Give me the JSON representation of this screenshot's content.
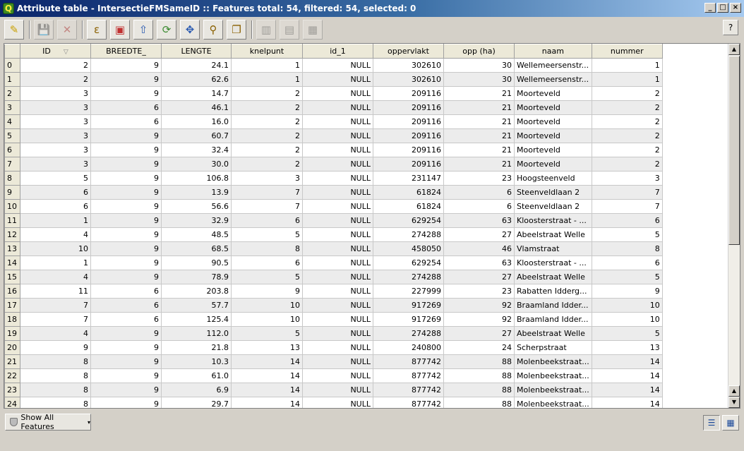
{
  "window": {
    "title": "Attribute table - IntersectieFMSameID :: Features total: 54, filtered: 54, selected: 0",
    "app_icon_letter": "Q",
    "minimize": "_",
    "maximize": "□",
    "close": "×"
  },
  "toolbar": {
    "icons": [
      {
        "name": "toggle-editing-icon",
        "glyph": "✎",
        "color": "#c8a000",
        "disabled": false
      },
      {
        "name": "save-edits-icon",
        "glyph": "💾",
        "color": "#606060",
        "disabled": true
      },
      {
        "name": "delete-selected-icon",
        "glyph": "✕",
        "color": "#b03030",
        "disabled": true
      },
      {
        "name": "expression-select-icon",
        "glyph": "ε",
        "color": "#8a6000",
        "disabled": false
      },
      {
        "name": "unselect-all-icon",
        "glyph": "▣",
        "color": "#c03030",
        "disabled": false
      },
      {
        "name": "move-selection-top-icon",
        "glyph": "⇧",
        "color": "#2a5ab0",
        "disabled": false
      },
      {
        "name": "invert-selection-icon",
        "glyph": "⟳",
        "color": "#3a8a30",
        "disabled": false
      },
      {
        "name": "pan-to-selection-icon",
        "glyph": "✥",
        "color": "#2a5ab0",
        "disabled": false
      },
      {
        "name": "zoom-to-selection-icon",
        "glyph": "⚲",
        "color": "#8a6000",
        "disabled": false
      },
      {
        "name": "copy-rows-icon",
        "glyph": "❐",
        "color": "#8a6000",
        "disabled": false
      },
      {
        "name": "new-column-icon",
        "glyph": "▥",
        "color": "#606060",
        "disabled": true
      },
      {
        "name": "delete-column-icon",
        "glyph": "▤",
        "color": "#606060",
        "disabled": true
      },
      {
        "name": "field-calculator-icon",
        "glyph": "▦",
        "color": "#606060",
        "disabled": true
      }
    ],
    "help": "?"
  },
  "table": {
    "columns": [
      "ID",
      "BREEDTE_",
      "LENGTE",
      "knelpunt",
      "id_1",
      "oppervlakt",
      "opp (ha)",
      "naam",
      "nummer"
    ],
    "sort_indicator": "▽",
    "rows": [
      [
        "0",
        "2",
        "9",
        "24.1",
        "1",
        "NULL",
        "302610",
        "30",
        "Wellemeersenstr...",
        "1"
      ],
      [
        "1",
        "2",
        "9",
        "62.6",
        "1",
        "NULL",
        "302610",
        "30",
        "Wellemeersenstr...",
        "1"
      ],
      [
        "2",
        "3",
        "9",
        "14.7",
        "2",
        "NULL",
        "209116",
        "21",
        "Moorteveld",
        "2"
      ],
      [
        "3",
        "3",
        "6",
        "46.1",
        "2",
        "NULL",
        "209116",
        "21",
        "Moorteveld",
        "2"
      ],
      [
        "4",
        "3",
        "6",
        "16.0",
        "2",
        "NULL",
        "209116",
        "21",
        "Moorteveld",
        "2"
      ],
      [
        "5",
        "3",
        "9",
        "60.7",
        "2",
        "NULL",
        "209116",
        "21",
        "Moorteveld",
        "2"
      ],
      [
        "6",
        "3",
        "9",
        "32.4",
        "2",
        "NULL",
        "209116",
        "21",
        "Moorteveld",
        "2"
      ],
      [
        "7",
        "3",
        "9",
        "30.0",
        "2",
        "NULL",
        "209116",
        "21",
        "Moorteveld",
        "2"
      ],
      [
        "8",
        "5",
        "9",
        "106.8",
        "3",
        "NULL",
        "231147",
        "23",
        "Hoogsteenveld",
        "3"
      ],
      [
        "9",
        "6",
        "9",
        "13.9",
        "7",
        "NULL",
        "61824",
        "6",
        "Steenveldlaan 2",
        "7"
      ],
      [
        "10",
        "6",
        "9",
        "56.6",
        "7",
        "NULL",
        "61824",
        "6",
        "Steenveldlaan 2",
        "7"
      ],
      [
        "11",
        "1",
        "9",
        "32.9",
        "6",
        "NULL",
        "629254",
        "63",
        "Kloosterstraat - ...",
        "6"
      ],
      [
        "12",
        "4",
        "9",
        "48.5",
        "5",
        "NULL",
        "274288",
        "27",
        "Abeelstraat Welle",
        "5"
      ],
      [
        "13",
        "10",
        "9",
        "68.5",
        "8",
        "NULL",
        "458050",
        "46",
        "Vlamstraat",
        "8"
      ],
      [
        "14",
        "1",
        "9",
        "90.5",
        "6",
        "NULL",
        "629254",
        "63",
        "Kloosterstraat - ...",
        "6"
      ],
      [
        "15",
        "4",
        "9",
        "78.9",
        "5",
        "NULL",
        "274288",
        "27",
        "Abeelstraat Welle",
        "5"
      ],
      [
        "16",
        "11",
        "6",
        "203.8",
        "9",
        "NULL",
        "227999",
        "23",
        "Rabatten Idderg...",
        "9"
      ],
      [
        "17",
        "7",
        "6",
        "57.7",
        "10",
        "NULL",
        "917269",
        "92",
        "Braamland Idder...",
        "10"
      ],
      [
        "18",
        "7",
        "6",
        "125.4",
        "10",
        "NULL",
        "917269",
        "92",
        "Braamland Idder...",
        "10"
      ],
      [
        "19",
        "4",
        "9",
        "112.0",
        "5",
        "NULL",
        "274288",
        "27",
        "Abeelstraat Welle",
        "5"
      ],
      [
        "20",
        "9",
        "9",
        "21.8",
        "13",
        "NULL",
        "240800",
        "24",
        "Scherpstraat",
        "13"
      ],
      [
        "21",
        "8",
        "9",
        "10.3",
        "14",
        "NULL",
        "877742",
        "88",
        "Molenbeekstraat...",
        "14"
      ],
      [
        "22",
        "8",
        "9",
        "61.0",
        "14",
        "NULL",
        "877742",
        "88",
        "Molenbeekstraat...",
        "14"
      ],
      [
        "23",
        "8",
        "9",
        "6.9",
        "14",
        "NULL",
        "877742",
        "88",
        "Molenbeekstraat...",
        "14"
      ],
      [
        "24",
        "8",
        "9",
        "29.7",
        "14",
        "NULL",
        "877742",
        "88",
        "Molenbeekstraat...",
        "14"
      ]
    ]
  },
  "scrollbar": {
    "up": "▲",
    "down": "▼",
    "up_bottom": "▲"
  },
  "bottom": {
    "show_all_label": "Show All Features",
    "chevron": "▾",
    "table_view_glyph": "☰",
    "form_view_glyph": "▦"
  }
}
